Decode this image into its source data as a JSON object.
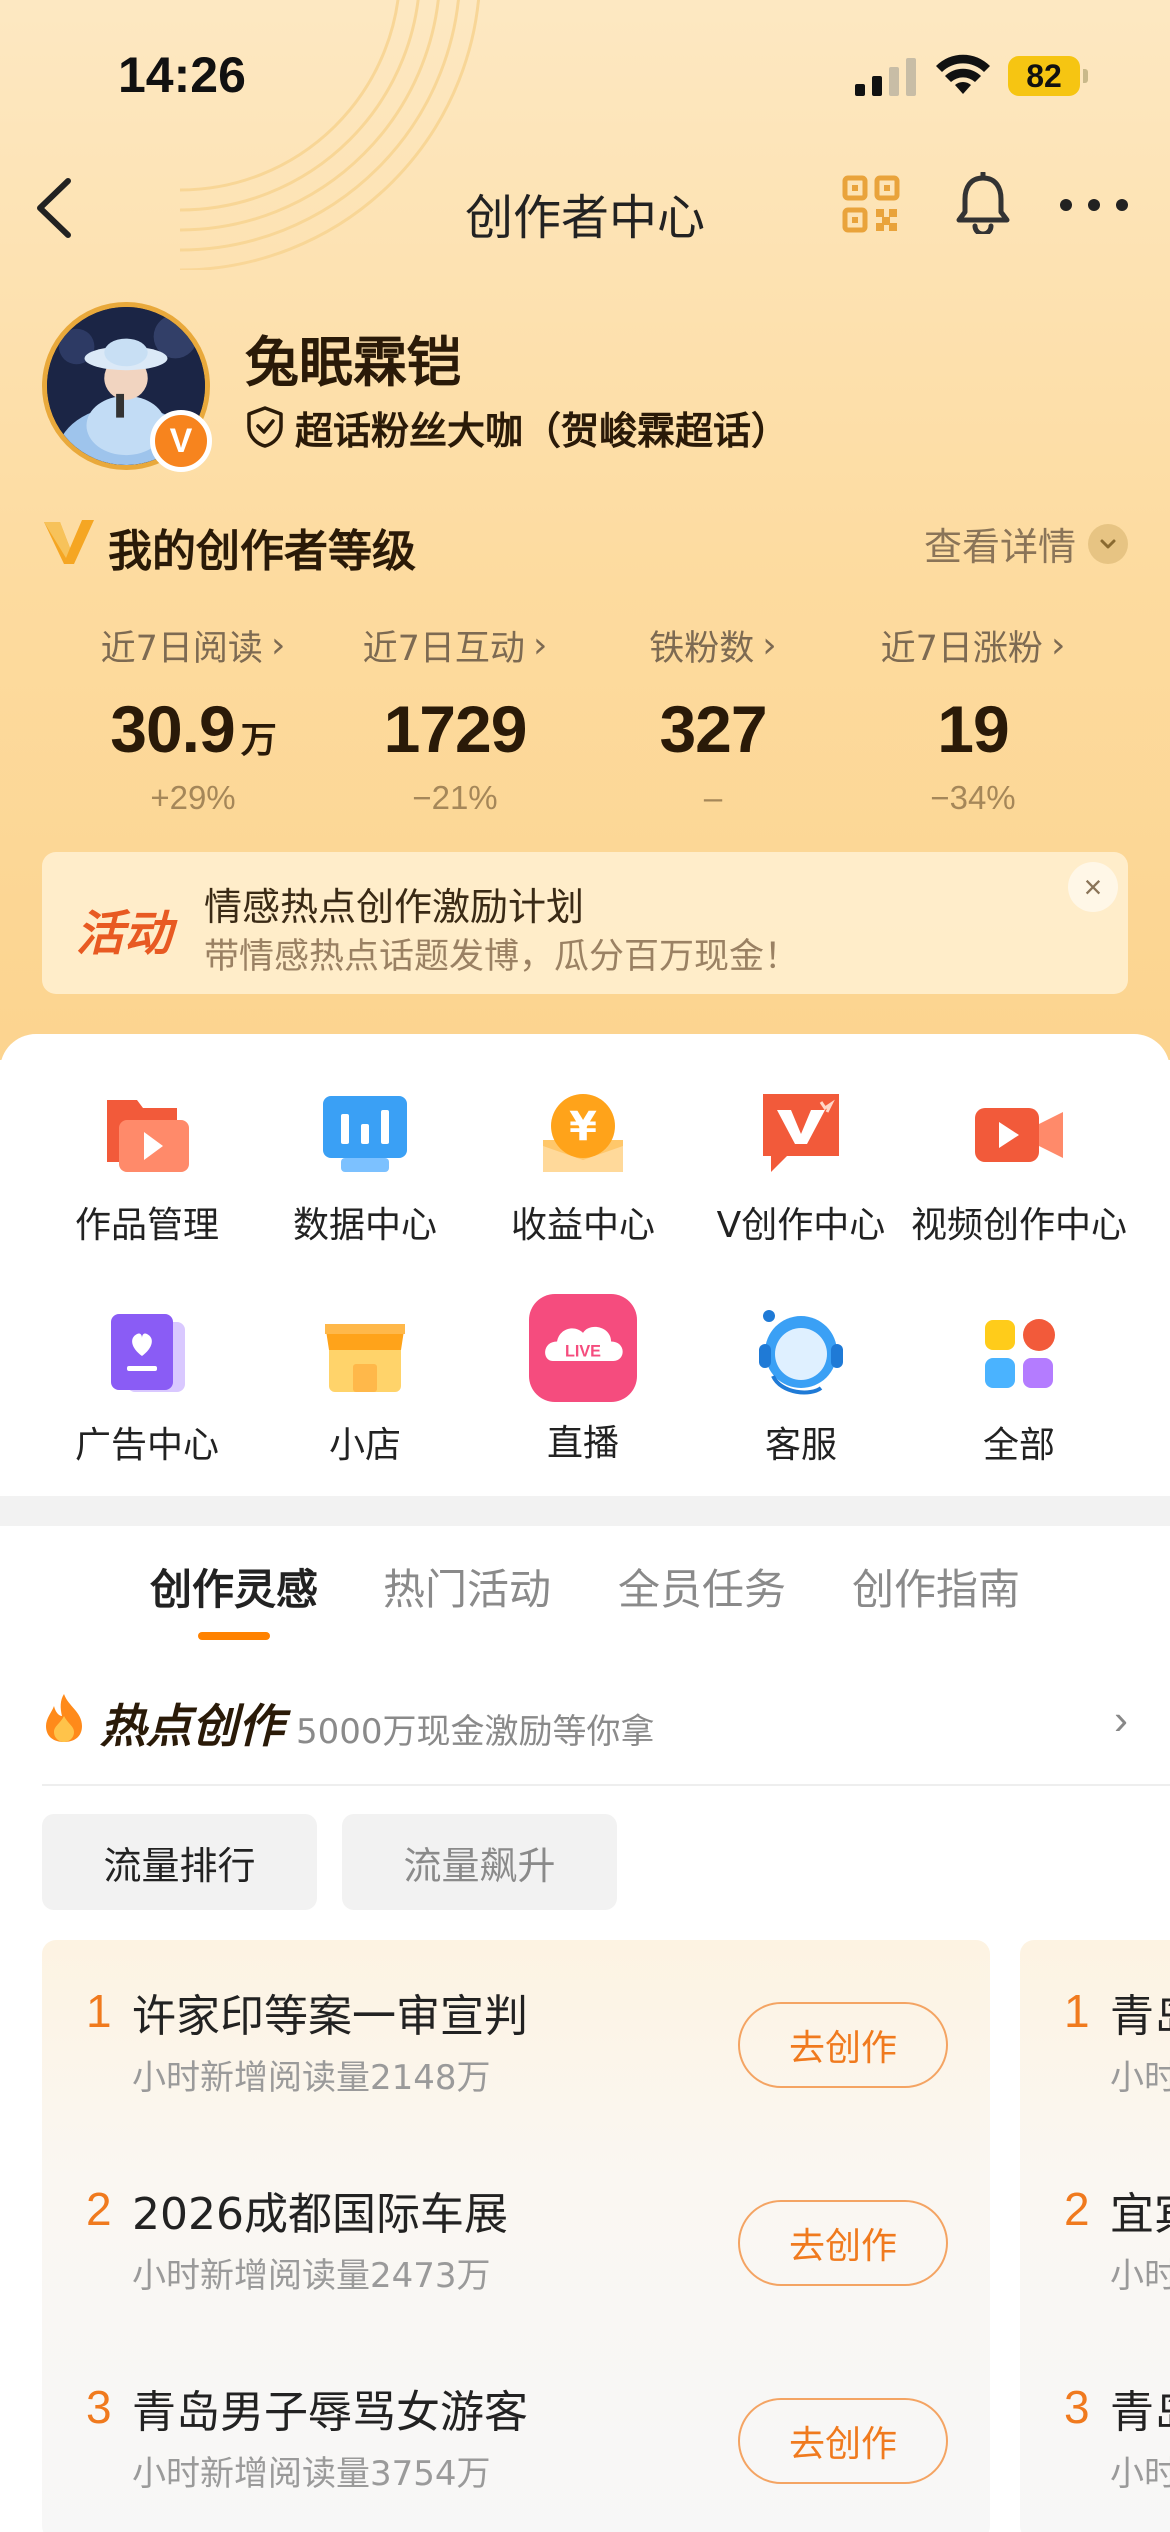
{
  "status_bar": {
    "time": "14:26",
    "battery": "82"
  },
  "nav": {
    "title": "创作者中心"
  },
  "profile": {
    "username": "兔眠霖铠",
    "v_badge": "V",
    "badge_text": "超话粉丝大咖（贺峻霖超话）"
  },
  "level": {
    "title": "我的创作者等级",
    "detail": "查看详情"
  },
  "stats": [
    {
      "label": "近7日阅读",
      "value": "30.9",
      "unit": "万",
      "change": "+29%"
    },
    {
      "label": "近7日互动",
      "value": "1729",
      "unit": "",
      "change": "−21%"
    },
    {
      "label": "铁粉数",
      "value": "327",
      "unit": "",
      "change": "–"
    },
    {
      "label": "近7日涨粉",
      "value": "19",
      "unit": "",
      "change": "−34%"
    }
  ],
  "banner": {
    "tag": "活动",
    "title": "情感热点创作激励计划",
    "subtitle": "带情感热点话题发博，瓜分百万现金！",
    "close": "×"
  },
  "tools": [
    {
      "label": "作品管理",
      "icon": "works-folder-icon"
    },
    {
      "label": "数据中心",
      "icon": "data-chart-icon"
    },
    {
      "label": "收益中心",
      "icon": "income-coin-icon"
    },
    {
      "label": "V创作中心",
      "icon": "v-create-icon"
    },
    {
      "label": "视频创作中心",
      "icon": "video-camera-icon"
    },
    {
      "label": "广告中心",
      "icon": "ad-book-icon"
    },
    {
      "label": "小店",
      "icon": "shop-icon"
    },
    {
      "label": "直播",
      "icon": "live-icon"
    },
    {
      "label": "客服",
      "icon": "customer-service-icon"
    },
    {
      "label": "全部",
      "icon": "all-grid-icon"
    }
  ],
  "live_icon_text": "LIVE",
  "tabs": [
    "创作灵感",
    "热门活动",
    "全员任务",
    "创作指南"
  ],
  "hot": {
    "title": "热点创作",
    "subtitle": "5000万现金激励等你拿",
    "chev": "›"
  },
  "chips": [
    "流量排行",
    "流量飙升"
  ],
  "ranking": [
    {
      "rank": "1",
      "title": "许家印等案一审宣判",
      "sub": "小时新增阅读量2148万",
      "button": "去创作"
    },
    {
      "rank": "2",
      "title": "2026成都国际车展",
      "sub": "小时新增阅读量2473万",
      "button": "去创作"
    },
    {
      "rank": "3",
      "title": "青岛男子辱骂女游客",
      "sub": "小时新增阅读量3754万",
      "button": "去创作"
    }
  ],
  "ranking_peek": [
    {
      "rank": "1",
      "title": "青岛",
      "sub": "小时"
    },
    {
      "rank": "2",
      "title": "宜宾",
      "sub": "小时"
    },
    {
      "rank": "3",
      "title": "青岛",
      "sub": "小时"
    }
  ],
  "colors": {
    "accent": "#ff8200",
    "rank": "#f07a1e",
    "header_bg": "#fddb9f"
  }
}
